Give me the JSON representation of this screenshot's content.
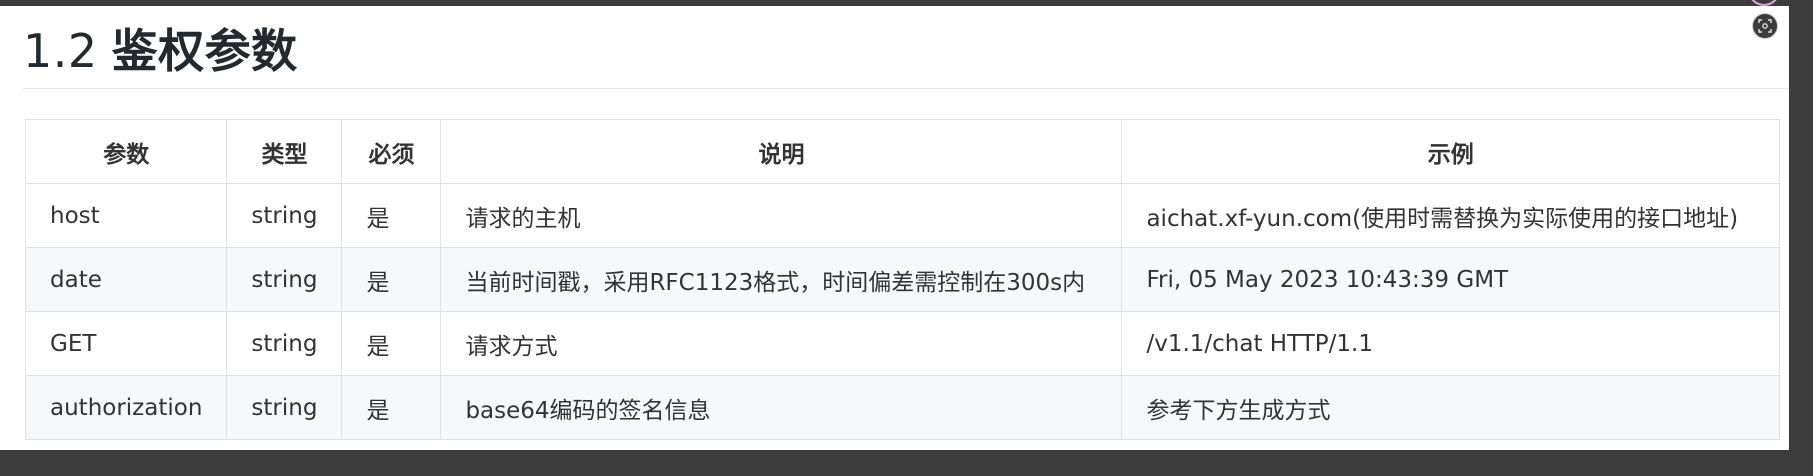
{
  "section": {
    "number": "1.2",
    "title": "鉴权参数"
  },
  "table": {
    "headers": [
      "参数",
      "类型",
      "必须",
      "说明",
      "示例"
    ],
    "rows": [
      [
        "host",
        "string",
        "是",
        "请求的主机",
        "aichat.xf-yun.com(使用时需替换为实际使用的接口地址)"
      ],
      [
        "date",
        "string",
        "是",
        "当前时间戳，采用RFC1123格式，时间偏差需控制在300s内",
        "Fri, 05 May 2023 10:43:39 GMT"
      ],
      [
        "GET",
        "string",
        "是",
        "请求方式",
        "/v1.1/chat HTTP/1.1"
      ],
      [
        "authorization",
        "string",
        "是",
        "base64编码的签名信息",
        "参考下方生成方式"
      ]
    ]
  },
  "icons": {
    "corner": "screenshot-capture-icon"
  }
}
